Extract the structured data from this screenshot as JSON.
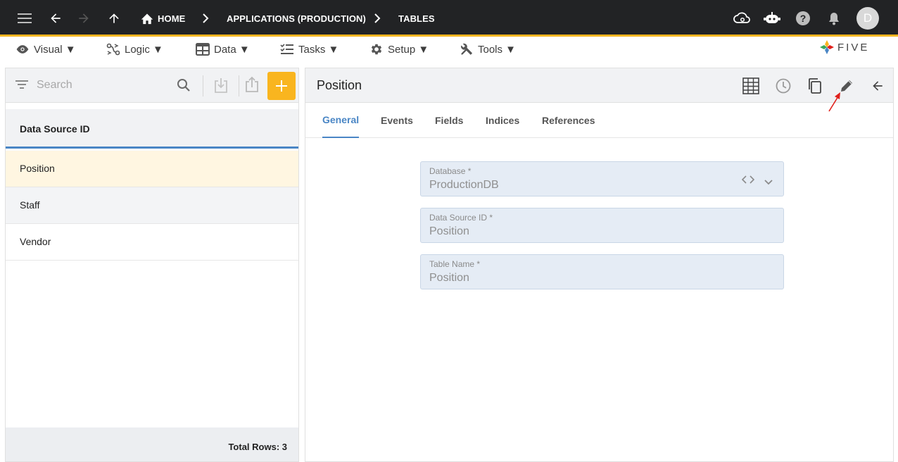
{
  "breadcrumbs": {
    "home": "HOME",
    "app": "APPLICATIONS (PRODUCTION)",
    "tables": "TABLES"
  },
  "user": {
    "avatar_initial": "D"
  },
  "menu": {
    "visual": "Visual ▼",
    "logic": "Logic ▼",
    "data": "Data ▼",
    "tasks": "Tasks ▼",
    "setup": "Setup ▼",
    "tools": "Tools ▼"
  },
  "logo": {
    "text": "FIVE"
  },
  "list": {
    "search_placeholder": "Search",
    "column_header": "Data Source ID",
    "rows": [
      "Position",
      "Staff",
      "Vendor"
    ],
    "total_rows": "Total Rows: 3"
  },
  "detail": {
    "title": "Position",
    "tabs": [
      "General",
      "Events",
      "Fields",
      "Indices",
      "References"
    ],
    "active_tab": "General",
    "fields": {
      "database_label": "Database *",
      "database_value": "ProductionDB",
      "ds_label": "Data Source ID *",
      "ds_value": "Position",
      "table_label": "Table Name *",
      "table_value": "Position"
    }
  },
  "colors": {
    "topbar": "#222325",
    "accent": "#f9b51f",
    "tab_active": "#4a86c5",
    "selected_row": "#fff6e1",
    "annotation_arrow": "#e0201b"
  }
}
